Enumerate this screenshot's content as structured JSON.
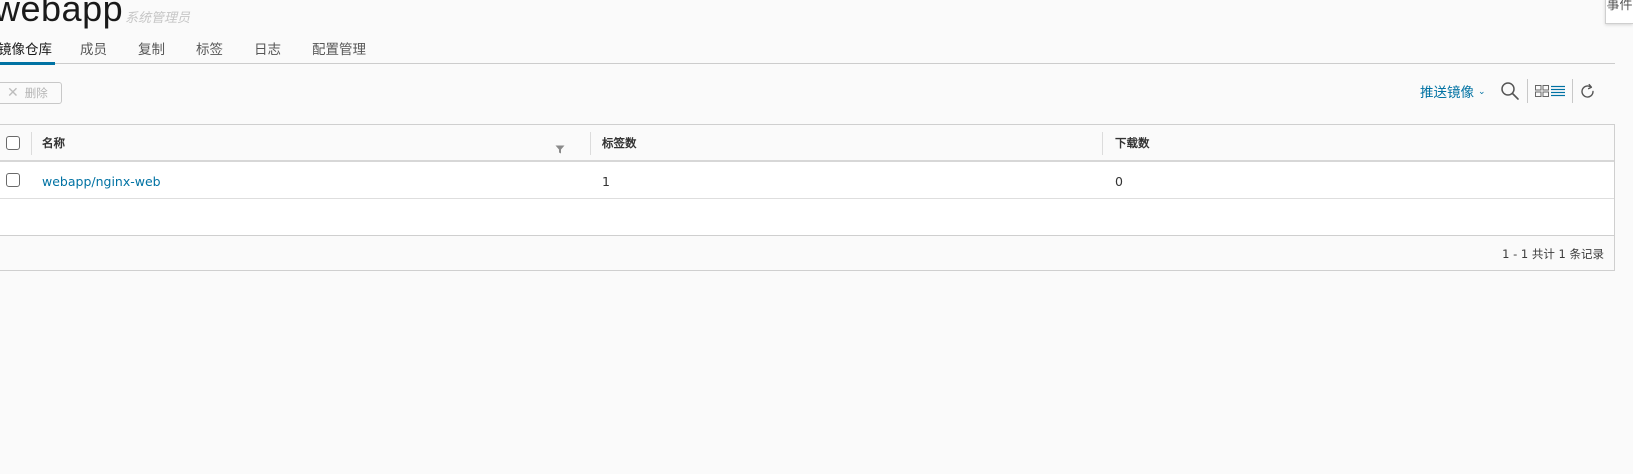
{
  "project": {
    "name": "webapp",
    "role": "系统管理员"
  },
  "edge_tab": {
    "label": "事件"
  },
  "tabs": [
    {
      "label": "镜像仓库",
      "active": true
    },
    {
      "label": "成员",
      "active": false
    },
    {
      "label": "复制",
      "active": false
    },
    {
      "label": "标签",
      "active": false
    },
    {
      "label": "日志",
      "active": false
    },
    {
      "label": "配置管理",
      "active": false
    }
  ],
  "toolbar": {
    "delete_label": "删除",
    "push_label": "推送镜像",
    "icons": [
      "search-icon",
      "card-view-icon",
      "list-view-icon",
      "refresh-icon"
    ]
  },
  "grid": {
    "columns": [
      "名称",
      "标签数",
      "下载数"
    ],
    "rows": [
      {
        "name": "webapp/nginx-web",
        "tags": "1",
        "pulls": "0"
      }
    ],
    "footer": "1 - 1 共计 1 条记录"
  },
  "colors": {
    "accent": "#0072a3",
    "background": "#fafafa",
    "border": "#cccccc"
  }
}
